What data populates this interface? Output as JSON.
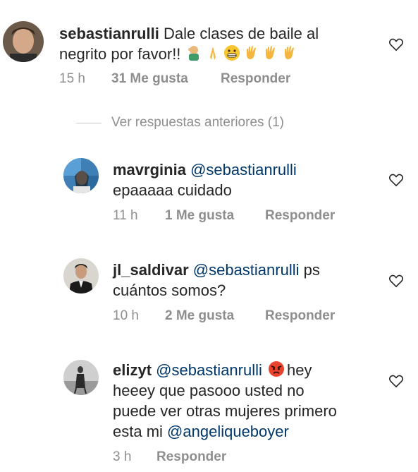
{
  "comments": [
    {
      "username": "sebastianrulli",
      "text": "Dale clases de baile al negrito por favor!!",
      "emojis": [
        "person-facepalming",
        "folded-hands",
        "grimacing-face",
        "waving-hand",
        "waving-hand",
        "waving-hand"
      ],
      "time": "15 h",
      "likes": "31 Me gusta",
      "reply": "Responder"
    },
    {
      "username": "mavrginia",
      "mention": "@sebastianrulli",
      "text": "epaaaaa cuidado",
      "time": "11 h",
      "likes": "1 Me gusta",
      "reply": "Responder"
    },
    {
      "username": "jl_saldivar",
      "mention": "@sebastianrulli",
      "text_inline": "ps",
      "text": "cuántos somos?",
      "time": "10 h",
      "likes": "2 Me gusta",
      "reply": "Responder"
    },
    {
      "username": "elizyt",
      "mention": "@sebastianrulli",
      "emoji": "angry-face",
      "text_inline": "hey",
      "text_line2": "heeey que pasooo usted no",
      "text_line3": "puede ver otras mujeres primero",
      "text_line4_prefix": "esta mi",
      "mention2": "@angeliqueboyer",
      "time": "3 h",
      "reply": "Responder"
    }
  ],
  "view_previous_replies": "Ver respuestas anteriores (1)",
  "colors": {
    "text": "#262626",
    "meta": "#8e8e8e",
    "mention": "#00376b",
    "divider": "#c7c7c7"
  }
}
